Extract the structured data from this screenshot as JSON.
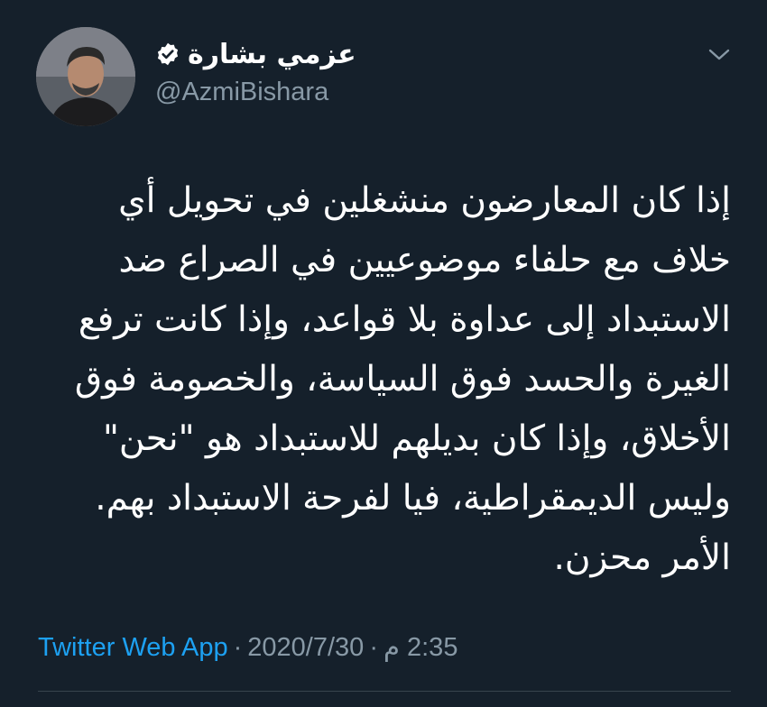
{
  "profile": {
    "display_name": "عزمي بشارة",
    "handle": "@AzmiBishara",
    "verified": true
  },
  "tweet": {
    "lines": [
      "إذا كان المعارضون منشغلين في تحويل أي",
      "خلاف مع حلفاء موضوعيين في الصراع ضد",
      "الاستبداد إلى عداوة بلا قواعد، وإذا كانت ترفع",
      "الغيرة والحسد فوق السياسة، والخصومة فوق",
      "الأخلاق، وإذا كان بديلهم للاستبداد  هو \"نحن\"",
      "وليس الديمقراطية، فيا لفرحة الاستبداد بهم.",
      "الأمر محزن."
    ]
  },
  "meta": {
    "time": "2:35 م",
    "date": "2020/7/30",
    "source": "Twitter Web App",
    "separator": "·"
  },
  "colors": {
    "background": "#15202b",
    "text": "#ffffff",
    "muted": "#8899a6",
    "accent": "#1da1f2"
  },
  "icons": {
    "verified": "verified-badge-icon",
    "menu": "chevron-down-icon"
  }
}
